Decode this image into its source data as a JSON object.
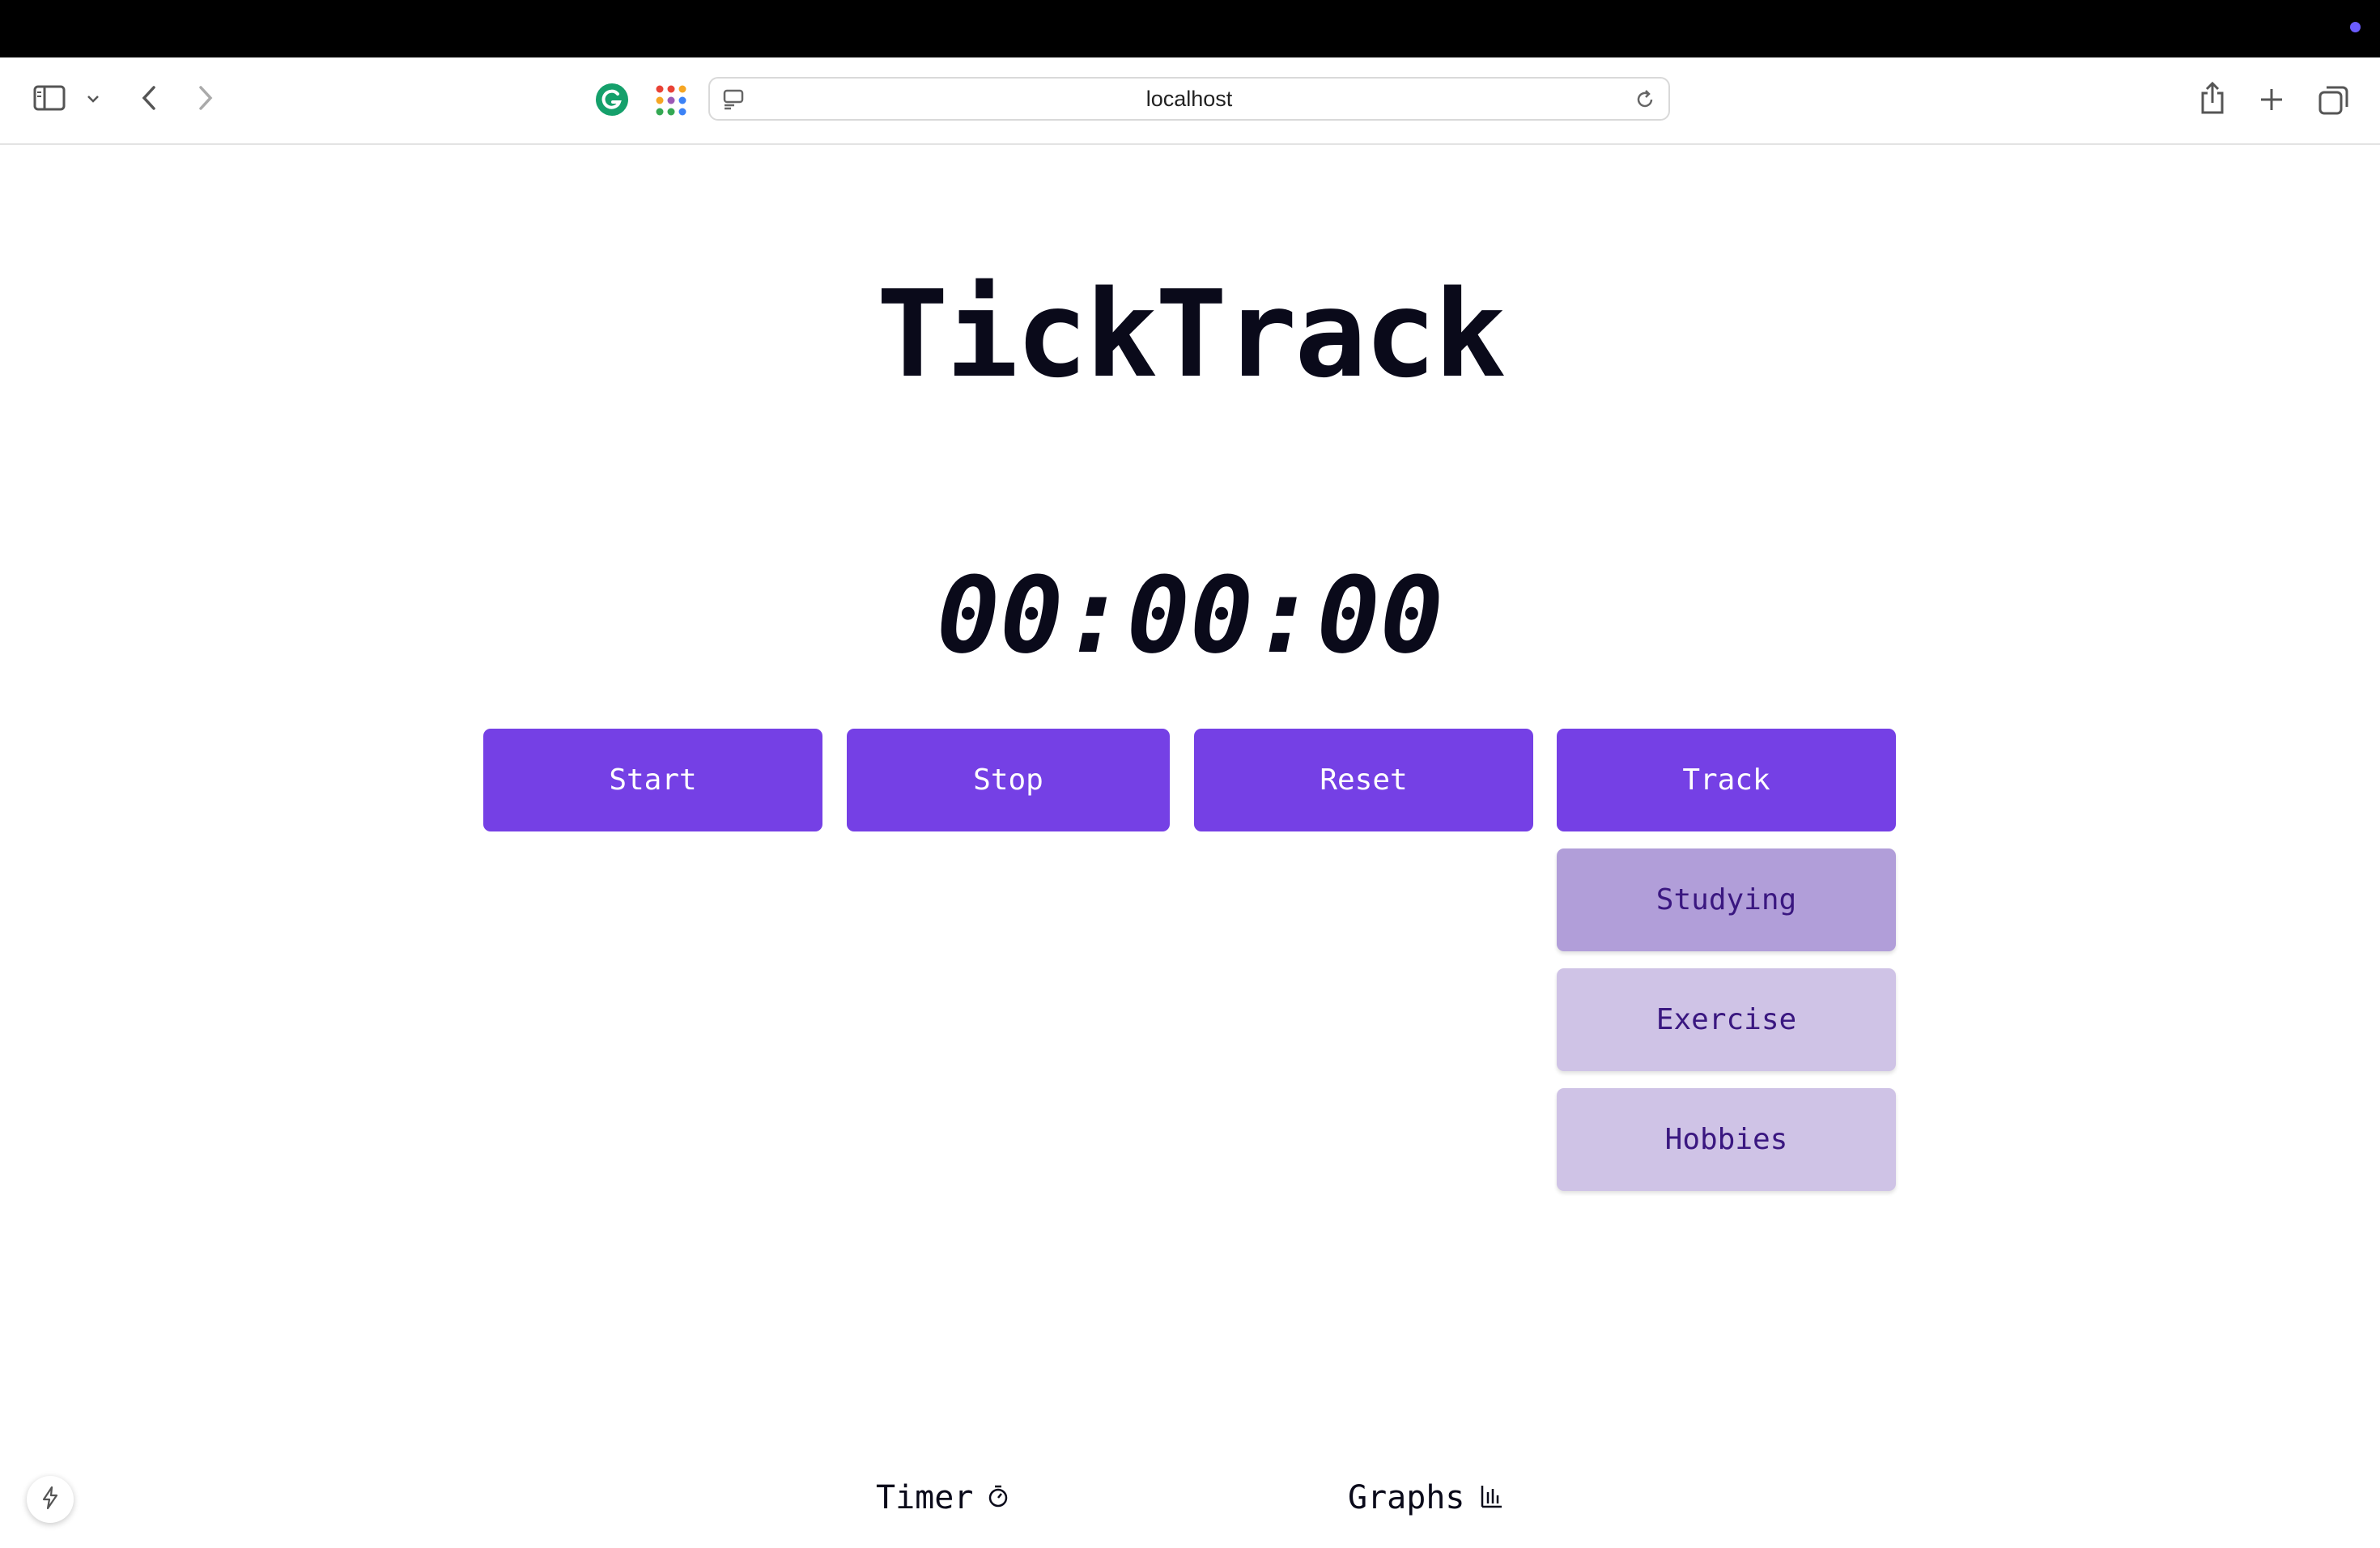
{
  "browser": {
    "url": "localhost"
  },
  "app": {
    "title": "TickTrack",
    "timer": "00:00:00"
  },
  "controls": {
    "start": "Start",
    "stop": "Stop",
    "reset": "Reset",
    "track": "Track"
  },
  "track_options": [
    {
      "label": "Studying",
      "selected": true,
      "color": "#b19ed9"
    },
    {
      "label": "Exercise",
      "selected": false,
      "color": "#cfc3e6"
    },
    {
      "label": "Hobbies",
      "selected": false,
      "color": "#cfc3e6"
    }
  ],
  "nav": {
    "timer": "Timer",
    "timer_icon": "stopwatch-icon",
    "graphs": "Graphs",
    "graphs_icon": "bar-chart-icon"
  },
  "colors": {
    "accent": "#7540e5",
    "text": "#0a0a1a"
  }
}
